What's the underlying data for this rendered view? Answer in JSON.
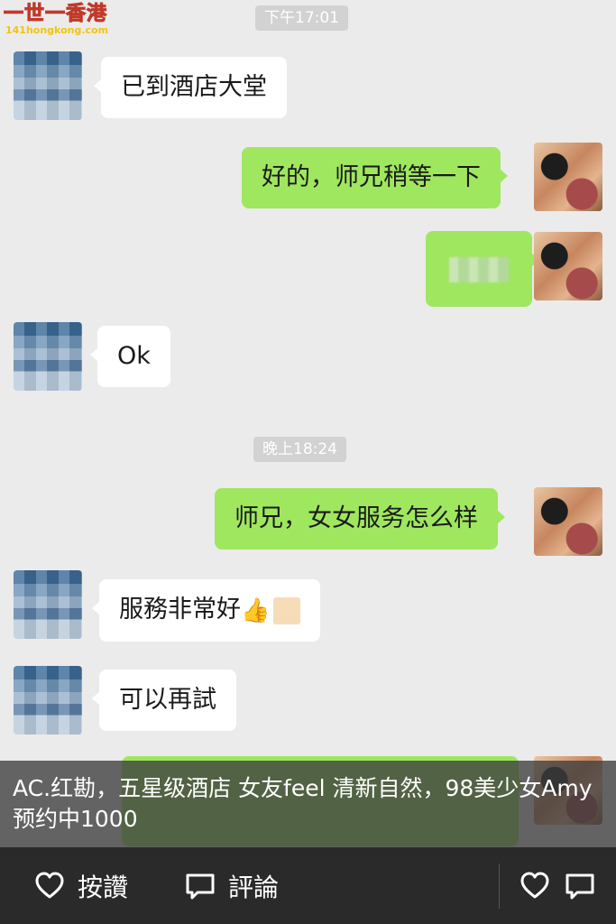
{
  "watermark": {
    "title": "一世一香港",
    "site": "141hongkong.com"
  },
  "timestamps": [
    "下午17:01",
    "晚上18:24"
  ],
  "messages": [
    {
      "side": "left",
      "text": "已到酒店大堂"
    },
    {
      "side": "right",
      "text": "好的，师兄稍等一下"
    },
    {
      "side": "right",
      "text": ""
    },
    {
      "side": "left",
      "text": "Ok"
    },
    {
      "side": "right",
      "text": "师兄，女女服务怎么样"
    },
    {
      "side": "left",
      "text": "服務非常好"
    },
    {
      "side": "left",
      "text": "可以再試"
    }
  ],
  "caption": "AC.红勘，五星级酒店 女友feel 清新自然，98美少女Amy 预约中1000",
  "actions": {
    "like": "按讚",
    "comment": "評論"
  },
  "colors": {
    "sent_bubble": "#9fe75f",
    "received_bubble": "#ffffff",
    "chat_bg": "#ebebeb",
    "action_bar": "#2a2a2a"
  },
  "icons": {
    "like": "heart-icon",
    "comment": "comment-icon",
    "thumb": "thumbs-up-emoji"
  }
}
